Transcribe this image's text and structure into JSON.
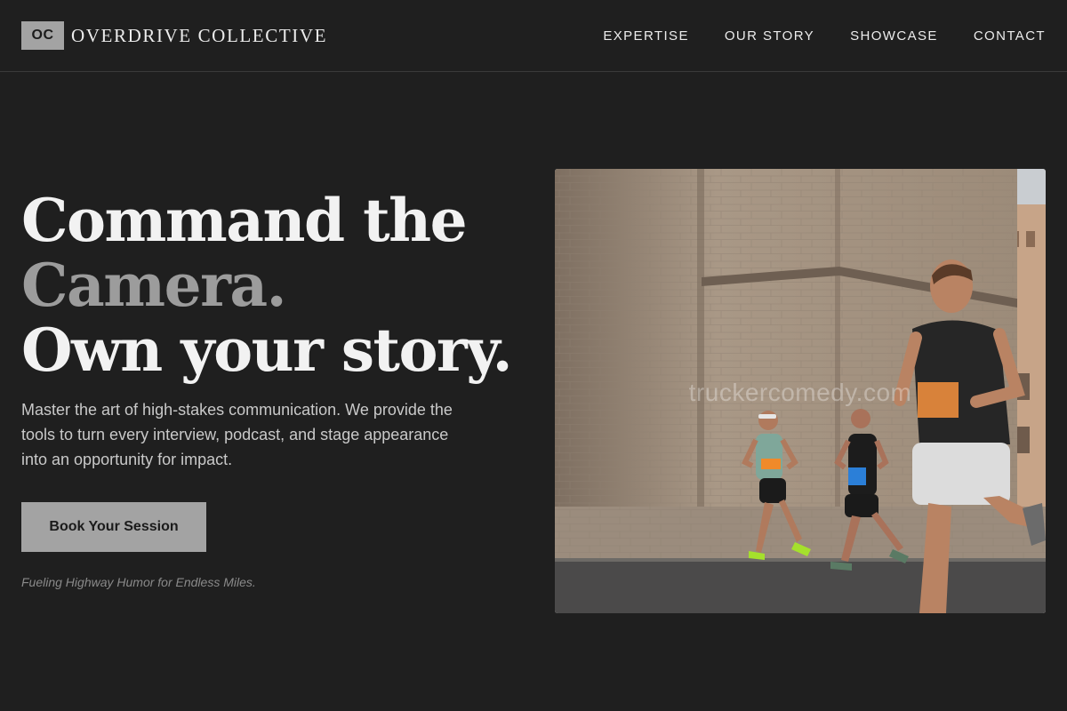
{
  "header": {
    "logo_mark": "OC",
    "brand_name": "OVERDRIVE COLLECTIVE",
    "nav": [
      {
        "label": "EXPERTISE"
      },
      {
        "label": "OUR STORY"
      },
      {
        "label": "SHOWCASE"
      },
      {
        "label": "CONTACT"
      }
    ]
  },
  "hero": {
    "headline_line1": "Command the",
    "headline_line2": "Camera.",
    "headline_line3": "Own your story.",
    "subcopy": "Master the art of high-stakes communication. We provide the tools to turn every interview, podcast, and stage appearance into an opportunity for impact.",
    "cta_label": "Book Your Session",
    "tagline": "Fueling Highway Humor for Endless Miles."
  },
  "photo": {
    "watermark": "truckercomedy.com"
  },
  "colors": {
    "background": "#1f1f1f",
    "accent_gray": "#a3a3a3",
    "muted_headline": "#9c9c9c"
  }
}
